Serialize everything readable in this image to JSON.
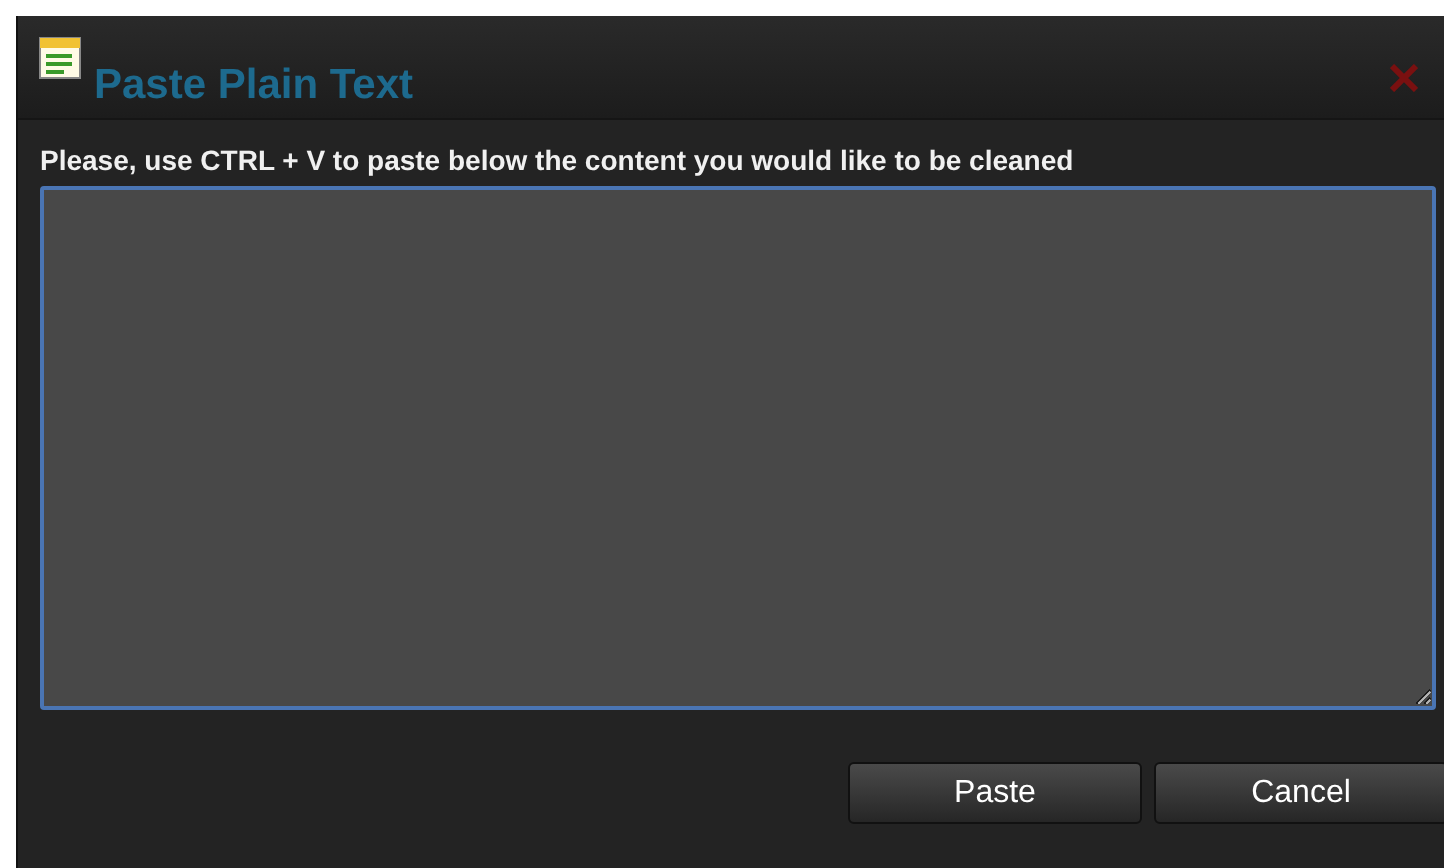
{
  "window": {
    "title": "Paste Plain Text"
  },
  "instruction": "Please, use CTRL + V to paste below the content you would like to be cleaned",
  "buttons": [
    {
      "label": "Paste"
    },
    {
      "label": "Cancel"
    }
  ]
}
